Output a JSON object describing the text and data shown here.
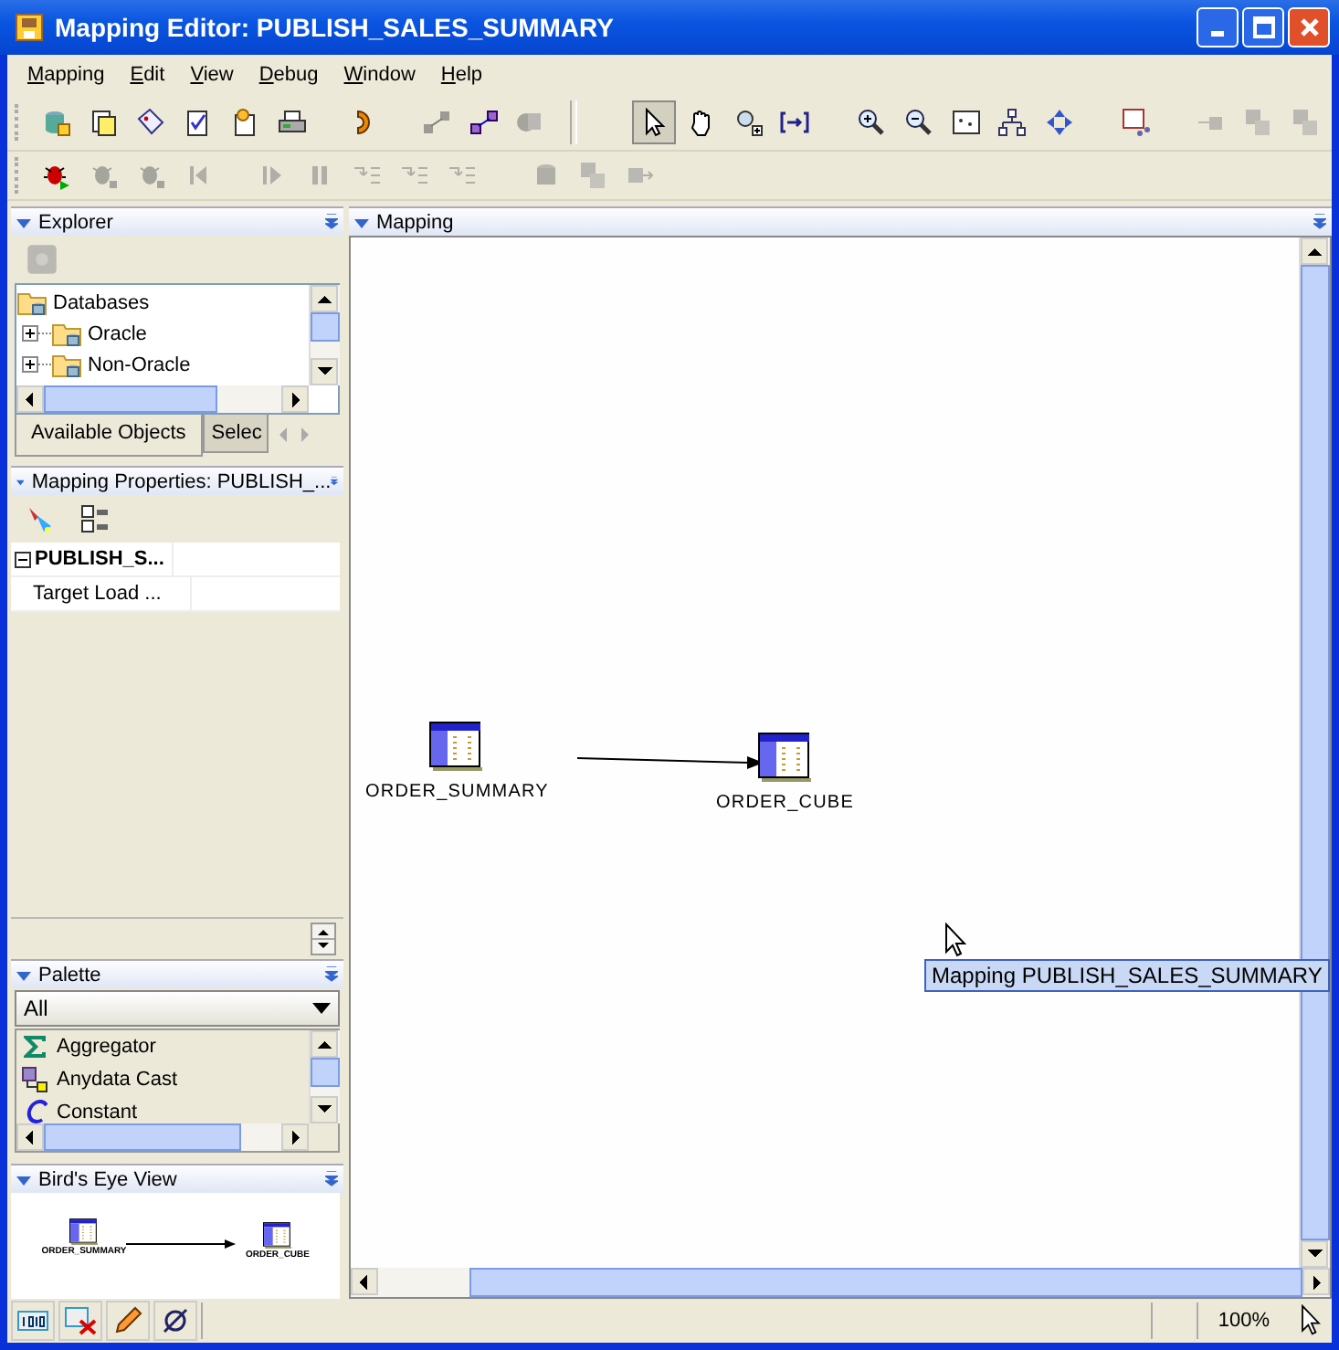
{
  "window": {
    "title": "Mapping Editor: PUBLISH_SALES_SUMMARY"
  },
  "menu": [
    "Mapping",
    "Edit",
    "View",
    "Debug",
    "Window",
    "Help"
  ],
  "toolbar_1": [
    {
      "selected": false,
      "disabled": false
    },
    {
      "selected": false,
      "disabled": false
    },
    {
      "selected": false,
      "disabled": false
    },
    {
      "selected": false,
      "disabled": false
    },
    {
      "selected": false,
      "disabled": false
    },
    {
      "selected": false,
      "disabled": false
    },
    {
      "selected": false,
      "disabled": false
    },
    {
      "selected": false,
      "disabled": true
    },
    {
      "selected": false,
      "disabled": false
    },
    {
      "selected": false,
      "disabled": true
    },
    {
      "selected": true,
      "disabled": false
    },
    {
      "selected": false,
      "disabled": false
    },
    {
      "selected": false,
      "disabled": false
    },
    {
      "selected": false,
      "disabled": false
    },
    {
      "selected": false,
      "disabled": false
    },
    {
      "selected": false,
      "disabled": false
    },
    {
      "selected": false,
      "disabled": false
    },
    {
      "selected": false,
      "disabled": false
    },
    {
      "selected": false,
      "disabled": false
    },
    {
      "selected": false,
      "disabled": false
    },
    {
      "selected": false,
      "disabled": true
    },
    {
      "selected": false,
      "disabled": true
    },
    {
      "selected": false,
      "disabled": true
    }
  ],
  "toolbar_2": [
    {
      "disabled": false
    },
    {
      "disabled": true
    },
    {
      "disabled": true
    },
    {
      "disabled": true
    },
    {
      "disabled": true
    },
    {
      "disabled": true
    },
    {
      "disabled": true
    },
    {
      "disabled": true
    },
    {
      "disabled": true
    },
    {
      "disabled": true
    },
    {
      "disabled": true
    },
    {
      "disabled": true
    }
  ],
  "explorer": {
    "title": "Explorer",
    "tree": [
      {
        "label": "Databases",
        "children": [
          {
            "label": "Oracle",
            "expanded": false
          },
          {
            "label": "Non-Oracle",
            "expanded": false
          }
        ]
      }
    ],
    "tabs": [
      {
        "label": "Available Objects",
        "selected": true
      },
      {
        "label": "Selec",
        "selected": false
      }
    ]
  },
  "properties": {
    "title": "Mapping Properties: PUBLISH_...",
    "rows": [
      {
        "label": "PUBLISH_S...",
        "kind": "group",
        "expanded": true
      },
      {
        "label": "Target Load ...",
        "kind": "property"
      }
    ]
  },
  "palette": {
    "title": "Palette",
    "filter": "All",
    "items": [
      {
        "label": "Aggregator",
        "kind": "sigma"
      },
      {
        "label": "Anydata Cast",
        "kind": "cast"
      },
      {
        "label": "Constant",
        "kind": "constant"
      }
    ]
  },
  "birds_eye": {
    "title": "Bird's Eye View",
    "nodes": [
      {
        "label": "ORDER_SUMMARY"
      },
      {
        "label": "ORDER_CUBE"
      }
    ]
  },
  "mapping": {
    "title": "Mapping",
    "nodes": [
      {
        "label": "ORDER_SUMMARY"
      },
      {
        "label": "ORDER_CUBE"
      }
    ],
    "tooltip": "Mapping PUBLISH_SALES_SUMMARY"
  },
  "status_bar": {
    "zoom": "100%"
  }
}
